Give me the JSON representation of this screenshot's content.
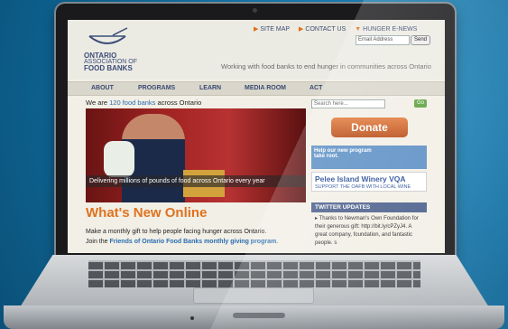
{
  "header": {
    "logo_line1": "ONTARIO",
    "logo_line2": "ASSOCIATION OF",
    "logo_line3": "FOOD BANKS",
    "links": [
      "SITE MAP",
      "CONTACT US",
      "HUNGER E-NEWS"
    ],
    "email_placeholder": "Email Address",
    "send_label": "Send",
    "tagline": "Working with food banks to end hunger in communities across Ontario"
  },
  "nav": {
    "items": [
      "ABOUT",
      "PROGRAMS",
      "LEARN",
      "MEDIA ROOM",
      "ACT"
    ]
  },
  "intro": {
    "prefix": "We are ",
    "link": "120 food banks",
    "suffix": " across Ontario"
  },
  "search": {
    "placeholder": "Search here...",
    "go_label": "Go"
  },
  "hero": {
    "caption": "Delivering millions of pounds of food across Ontario every year"
  },
  "sidebar": {
    "donate_label": "Donate",
    "promo_line1": "Help our new program",
    "promo_line2": "take root.",
    "pelee_title": "Pelee Island Winery VQA",
    "pelee_sub": "SUPPORT THE OAFB WITH LOCAL WINE",
    "twitter_header": "TWITTER UPDATES",
    "tweet": "Thanks to Newman's Own Foundation for their generous gift: http://bit.ly/cPZyJ4. A great company, foundation, and fantastic people. s"
  },
  "whats_new": {
    "heading": "What's New Online",
    "text1": "Make a monthly gift to help people facing hunger across Ontario.",
    "text2_prefix": "Join the ",
    "text2_link": "Friends of Ontario Food Banks monthly giving program",
    "text2_suffix": "."
  },
  "colors": {
    "accent": "#e0721e",
    "nav_text": "#3a4a72",
    "link": "#2a6db0",
    "background": "#1270a3"
  }
}
